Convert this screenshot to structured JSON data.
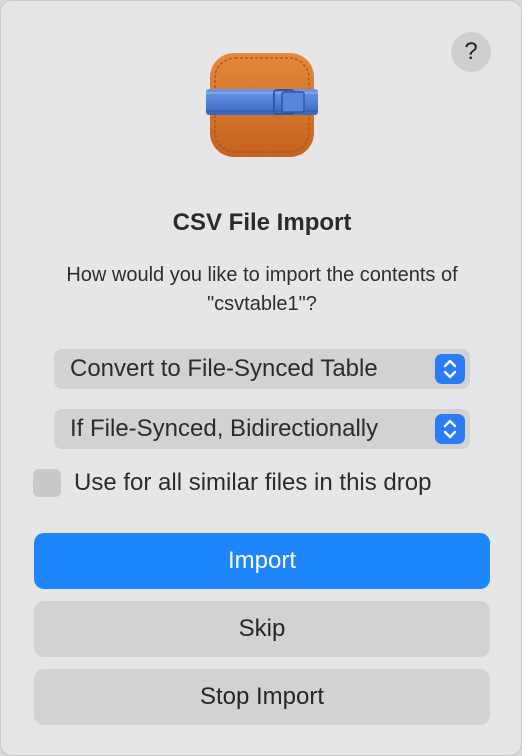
{
  "dialog": {
    "title": "CSV File Import",
    "message": "How would you like to import the contents of \"csvtable1\"?",
    "help_label": "?"
  },
  "import_mode": {
    "selected": "Convert to File-Synced Table"
  },
  "sync_direction": {
    "selected": "If File-Synced, Bidirectionally"
  },
  "apply_all": {
    "label": "Use for all similar files in this drop",
    "checked": false
  },
  "buttons": {
    "import": "Import",
    "skip": "Skip",
    "stop": "Stop Import"
  },
  "colors": {
    "accent": "#1e86fb",
    "icon_leather": "#d8772f",
    "icon_band": "#4d7fd6"
  },
  "icons": {
    "app": "leather-case-icon",
    "stepper": "chevron-updown-icon"
  }
}
